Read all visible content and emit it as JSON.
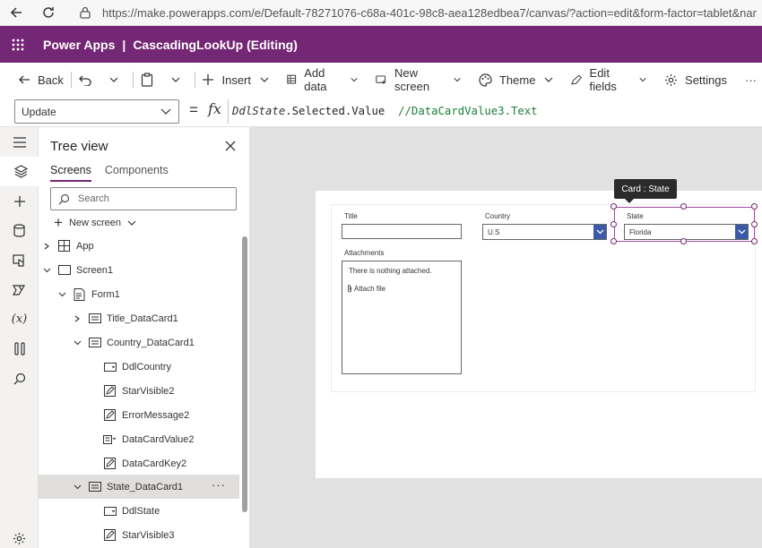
{
  "browser": {
    "url": "https://make.powerapps.com/e/Default-78271076-c68a-401c-98c8-aea128edbea7/canvas/?action=edit&form-factor=tablet&name=Cascadi"
  },
  "app": {
    "brand": "Power Apps",
    "separator": "|",
    "title": "CascadingLookUp (Editing)"
  },
  "commands": {
    "back": "Back",
    "insert": "Insert",
    "add_data": "Add data",
    "new_screen": "New screen",
    "theme": "Theme",
    "edit_fields": "Edit fields",
    "settings": "Settings",
    "more": "···"
  },
  "formula_bar": {
    "property": "Update",
    "equals": "=",
    "fx": "fx",
    "formula_control": "DdlState",
    "formula_member": ".Selected.Value",
    "formula_comment": "//DataCardValue3.Text"
  },
  "tree": {
    "title": "Tree view",
    "tabs": [
      "Screens",
      "Components"
    ],
    "search_placeholder": "Search",
    "new_screen": "New screen",
    "nodes": {
      "app": "App",
      "screen1": "Screen1",
      "form1": "Form1",
      "title_card": "Title_DataCard1",
      "country_card": "Country_DataCard1",
      "ddl_country": "DdlCountry",
      "star_visible2": "StarVisible2",
      "error_message2": "ErrorMessage2",
      "data_card_value2": "DataCardValue2",
      "data_card_key2": "DataCardKey2",
      "state_card": "State_DataCard1",
      "ddl_state": "DdlState",
      "star_visible3": "StarVisible3"
    },
    "node_more": "···"
  },
  "canvas": {
    "tooltip": "Card : State",
    "fields": {
      "title_label": "Title",
      "country_label": "Country",
      "country_value": "U.S",
      "state_label": "State",
      "state_value": "Florida",
      "attachments_label": "Attachments",
      "attachments_empty": "There is nothing attached.",
      "attach_file": "Attach file"
    }
  },
  "colors": {
    "brand_purple": "#742774",
    "dropdown_blue": "#3b5ba9",
    "selection_purple": "#a34ea3"
  }
}
